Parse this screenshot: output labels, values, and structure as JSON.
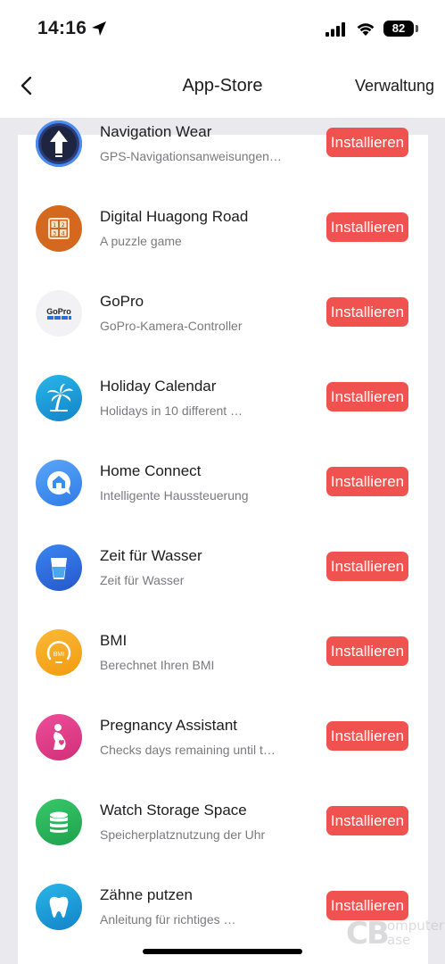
{
  "status_bar": {
    "time": "14:16",
    "battery": "82"
  },
  "nav": {
    "title": "App-Store",
    "manage": "Verwaltung"
  },
  "apps": [
    {
      "name": "Navigation Wear",
      "description": "GPS-Navigationsanweisungen…",
      "install_label": "Installieren",
      "icon": "navigation-arrow-icon",
      "color": "#2c3d7a"
    },
    {
      "name": "Digital Huagong Road",
      "description": "A puzzle game",
      "install_label": "Installieren",
      "icon": "number-puzzle-icon",
      "color": "#d4681e"
    },
    {
      "name": "GoPro",
      "description": "GoPro-Kamera-Controller",
      "install_label": "Installieren",
      "icon": "gopro-logo-icon",
      "color": "#f2f2f4"
    },
    {
      "name": "Holiday Calendar",
      "description": "Holidays in 10 different …",
      "install_label": "Installieren",
      "icon": "palm-tree-icon",
      "color": "#1f9fd8"
    },
    {
      "name": "Home Connect",
      "description": "Intelligente Haussteuerung",
      "install_label": "Installieren",
      "icon": "home-chat-icon",
      "color": "#3b8ef0"
    },
    {
      "name": "Zeit für Wasser",
      "description": "Zeit für Wasser",
      "install_label": "Installieren",
      "icon": "water-glass-icon",
      "color": "#2e6fe0"
    },
    {
      "name": "BMI",
      "description": "Berechnet Ihren BMI",
      "install_label": "Installieren",
      "icon": "bmi-gauge-icon",
      "color": "#f5a623"
    },
    {
      "name": "Pregnancy Assistant",
      "description": "Checks days remaining until t…",
      "install_label": "Installieren",
      "icon": "pregnancy-icon",
      "color": "#e0408a"
    },
    {
      "name": "Watch Storage Space",
      "description": "Speicherplatznutzung der Uhr",
      "install_label": "Installieren",
      "icon": "database-stack-icon",
      "color": "#27b45a"
    },
    {
      "name": "Zähne putzen",
      "description": "Anleitung für richtiges …",
      "install_label": "Installieren",
      "icon": "tooth-icon",
      "color": "#1f9fd8"
    }
  ],
  "watermark": {
    "initials": "CB",
    "word_top": "omputer",
    "word_bottom": "ase"
  }
}
